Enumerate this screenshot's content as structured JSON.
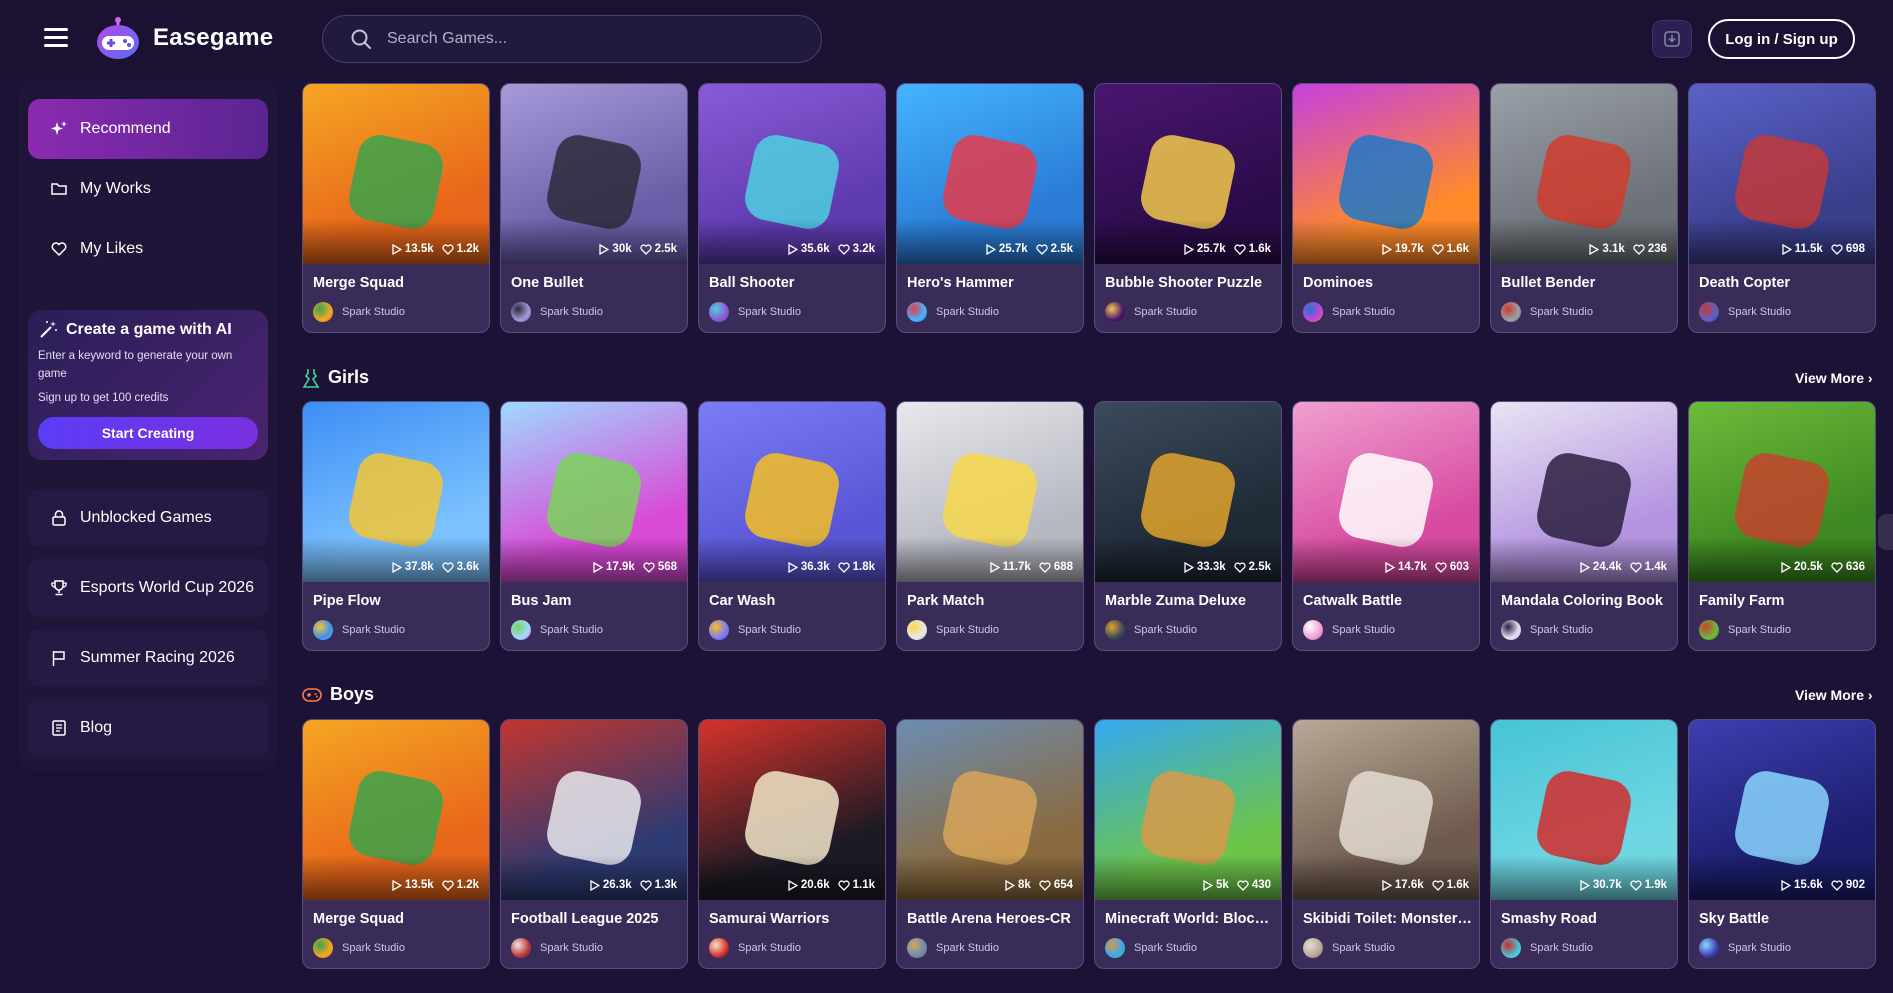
{
  "header": {
    "brand": "Easegame",
    "search_placeholder": "Search Games...",
    "login_label": "Log in / Sign up"
  },
  "sidebar": {
    "items": [
      {
        "label": "Recommend",
        "icon": "sparkle-icon"
      },
      {
        "label": "My Works",
        "icon": "folder-icon"
      },
      {
        "label": "My Likes",
        "icon": "heart-icon"
      }
    ],
    "ai_card": {
      "title": "Create a game with AI",
      "description": "Enter a keyword to generate your own game",
      "credits": "Sign up to get 100 credits",
      "button": "Start Creating"
    },
    "links": [
      {
        "label": "Unblocked Games",
        "icon": "lock-icon"
      },
      {
        "label": "Esports World Cup 2026",
        "icon": "trophy-icon"
      },
      {
        "label": "Summer Racing 2026",
        "icon": "flag-icon"
      },
      {
        "label": "Blog",
        "icon": "blog-icon"
      }
    ]
  },
  "sections": [
    {
      "title": "",
      "view_more": "",
      "games": [
        {
          "title": "Merge Squad",
          "plays": "13.5k",
          "likes": "1.2k",
          "studio": "Spark Studio",
          "colors": [
            "#f5a623",
            "#e8661a",
            "#3aa34b"
          ]
        },
        {
          "title": "One Bullet",
          "plays": "30k",
          "likes": "2.5k",
          "studio": "Spark Studio",
          "colors": [
            "#a79ad8",
            "#6a5ea8",
            "#2b2b3a"
          ]
        },
        {
          "title": "Ball Shooter",
          "plays": "35.6k",
          "likes": "3.2k",
          "studio": "Spark Studio",
          "colors": [
            "#8a5ad6",
            "#5e3bb0",
            "#4fd0e0"
          ]
        },
        {
          "title": "Hero's Hammer",
          "plays": "25.7k",
          "likes": "2.5k",
          "studio": "Spark Studio",
          "colors": [
            "#44b4ff",
            "#2a7cd6",
            "#e53b4b"
          ]
        },
        {
          "title": "Bubble Shooter Puzzle",
          "plays": "25.7k",
          "likes": "1.6k",
          "studio": "Spark Studio",
          "colors": [
            "#4a1670",
            "#2b0c4a",
            "#f2c94c"
          ]
        },
        {
          "title": "Dominoes",
          "plays": "19.7k",
          "likes": "1.6k",
          "studio": "Spark Studio",
          "colors": [
            "#c640e0",
            "#ff8a2a",
            "#1e78c8"
          ]
        },
        {
          "title": "Bullet Bender",
          "plays": "3.1k",
          "likes": "236",
          "studio": "Spark Studio",
          "colors": [
            "#9aa0a8",
            "#6d7278",
            "#d13b2b"
          ]
        },
        {
          "title": "Death Copter",
          "plays": "11.5k",
          "likes": "698",
          "studio": "Spark Studio",
          "colors": [
            "#5b62c8",
            "#3a3f8c",
            "#c33a3a"
          ]
        }
      ]
    },
    {
      "title": "Girls",
      "view_more": "View More",
      "games": [
        {
          "title": "Pipe Flow",
          "plays": "37.8k",
          "likes": "3.6k",
          "studio": "Spark Studio",
          "colors": [
            "#3d8ef5",
            "#7bc1ff",
            "#f5c534"
          ]
        },
        {
          "title": "Bus Jam",
          "plays": "17.9k",
          "likes": "568",
          "studio": "Spark Studio",
          "colors": [
            "#9fd9ff",
            "#d94ad6",
            "#7ad45b"
          ]
        },
        {
          "title": "Car Wash",
          "plays": "36.3k",
          "likes": "1.8k",
          "studio": "Spark Studio",
          "colors": [
            "#7b7cf5",
            "#5a57d6",
            "#f5c023"
          ]
        },
        {
          "title": "Park Match",
          "plays": "11.7k",
          "likes": "688",
          "studio": "Spark Studio",
          "colors": [
            "#e8e8ec",
            "#b7b9c2",
            "#f7d84b"
          ]
        },
        {
          "title": "Marble Zuma Deluxe",
          "plays": "33.3k",
          "likes": "2.5k",
          "studio": "Spark Studio",
          "colors": [
            "#3b4a5c",
            "#1f2a36",
            "#e0a32c"
          ]
        },
        {
          "title": "Catwalk Battle",
          "plays": "14.7k",
          "likes": "603",
          "studio": "Spark Studio",
          "colors": [
            "#f0a0d0",
            "#d74aa0",
            "#ffffff"
          ]
        },
        {
          "title": "Mandala Coloring Book",
          "plays": "24.4k",
          "likes": "1.4k",
          "studio": "Spark Studio",
          "colors": [
            "#e9e4f3",
            "#b494e0",
            "#2b2040"
          ]
        },
        {
          "title": "Family Farm",
          "plays": "20.5k",
          "likes": "636",
          "studio": "Spark Studio",
          "colors": [
            "#6dbb3a",
            "#3e8a22",
            "#c4432e"
          ]
        }
      ]
    },
    {
      "title": "Boys",
      "view_more": "View More",
      "games": [
        {
          "title": "Merge Squad",
          "plays": "13.5k",
          "likes": "1.2k",
          "studio": "Spark Studio",
          "colors": [
            "#f5a623",
            "#e8661a",
            "#3aa34b"
          ]
        },
        {
          "title": "Football League 2025",
          "plays": "26.3k",
          "likes": "1.3k",
          "studio": "Spark Studio",
          "colors": [
            "#c2362f",
            "#2e3a72",
            "#e9e9ef"
          ]
        },
        {
          "title": "Samurai Warriors",
          "plays": "20.6k",
          "likes": "1.1k",
          "studio": "Spark Studio",
          "colors": [
            "#d8322b",
            "#1c1a24",
            "#f2e6c9"
          ]
        },
        {
          "title": "Battle Arena Heroes-CR",
          "plays": "8k",
          "likes": "654",
          "studio": "Spark Studio",
          "colors": [
            "#6b8db3",
            "#8a6a3e",
            "#d8a45a"
          ]
        },
        {
          "title": "Minecraft World: Block ...",
          "plays": "5k",
          "likes": "430",
          "studio": "Spark Studio",
          "colors": [
            "#35a8f0",
            "#6cc44a",
            "#d99a4a"
          ]
        },
        {
          "title": "Skibidi Toilet: Monster ...",
          "plays": "17.6k",
          "likes": "1.6k",
          "studio": "Spark Studio",
          "colors": [
            "#b9a898",
            "#6e5b4d",
            "#e4dcd2"
          ]
        },
        {
          "title": "Smashy Road",
          "plays": "30.7k",
          "likes": "1.9k",
          "studio": "Spark Studio",
          "colors": [
            "#46c4d6",
            "#6fd7e2",
            "#d42b2b"
          ]
        },
        {
          "title": "Sky Battle",
          "plays": "15.6k",
          "likes": "902",
          "studio": "Spark Studio",
          "colors": [
            "#3c3fb0",
            "#1c1e6e",
            "#8ad6ff"
          ]
        }
      ]
    }
  ]
}
